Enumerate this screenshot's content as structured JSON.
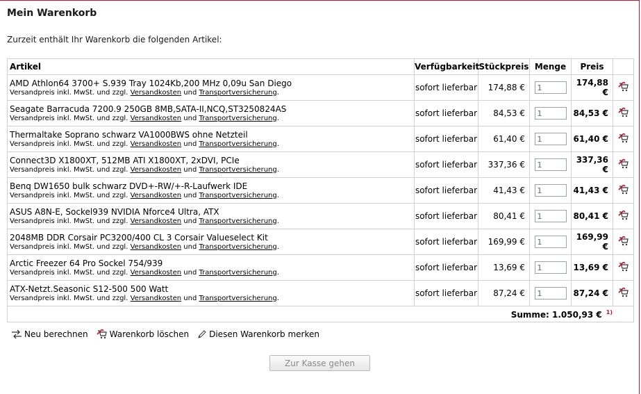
{
  "page": {
    "title": "Mein Warenkorb",
    "intro": "Zurzeit enthält Ihr Warenkorb die folgenden Artikel:"
  },
  "table": {
    "headers": {
      "article": "Artikel",
      "availability": "Verfügbarkeit",
      "unit_price": "Stückpreis",
      "quantity": "Menge",
      "price": "Preis"
    },
    "note": {
      "prefix": "Versandpreis inkl. MwSt. und zzgl. ",
      "link1": "Versandkosten",
      "middle": " und ",
      "link2": "Transportversicherung",
      "suffix": "."
    },
    "items": [
      {
        "name": "AMD Athlon64 3700+ S.939 Tray 1024Kb,200 MHz 0,09u San Diego",
        "availability": "sofort lieferbar",
        "unit_price": "174,88 €",
        "qty": "1",
        "price": "174,88 €"
      },
      {
        "name": "Seagate Barracuda 7200.9 250GB 8MB,SATA-II,NCQ,ST3250824AS",
        "availability": "sofort lieferbar",
        "unit_price": "84,53 €",
        "qty": "1",
        "price": "84,53 €"
      },
      {
        "name": "Thermaltake Soprano schwarz VA1000BWS ohne Netzteil",
        "availability": "sofort lieferbar",
        "unit_price": "61,40 €",
        "qty": "1",
        "price": "61,40 €"
      },
      {
        "name": "Connect3D X1800XT, 512MB ATI X1800XT, 2xDVI, PCIe",
        "availability": "sofort lieferbar",
        "unit_price": "337,36 €",
        "qty": "1",
        "price": "337,36 €"
      },
      {
        "name": "Benq DW1650 bulk schwarz DVD+-RW/+-R-Laufwerk IDE",
        "availability": "sofort lieferbar",
        "unit_price": "41,43 €",
        "qty": "1",
        "price": "41,43 €"
      },
      {
        "name": "ASUS A8N-E, Sockel939 NVIDIA Nforce4 Ultra, ATX",
        "availability": "sofort lieferbar",
        "unit_price": "80,41 €",
        "qty": "1",
        "price": "80,41 €"
      },
      {
        "name": "2048MB DDR Corsair PC3200/400 CL 3 Corsair Valueselect Kit",
        "availability": "sofort lieferbar",
        "unit_price": "169,99 €",
        "qty": "1",
        "price": "169,99 €"
      },
      {
        "name": "Arctic Freezer 64 Pro Sockel 754/939",
        "availability": "sofort lieferbar",
        "unit_price": "13,69 €",
        "qty": "1",
        "price": "13,69 €"
      },
      {
        "name": "ATX-Netzt.Seasonic S12-500 500 Watt",
        "availability": "sofort lieferbar",
        "unit_price": "87,24 €",
        "qty": "1",
        "price": "87,24 €"
      }
    ],
    "sum_label": "Summe: 1.050,93 €",
    "sum_footnote": "1)"
  },
  "actions": {
    "recalc": "Neu berechnen",
    "clear": "Warenkorb löschen",
    "remember": "Diesen Warenkorb merken"
  },
  "checkout": {
    "label": "Zur Kasse gehen"
  },
  "icons": {
    "delete": "cart-delete-icon",
    "recalc": "recalc-icon",
    "clear": "cart-clear-icon",
    "remember": "pencil-icon"
  },
  "colors": {
    "accent": "#c8102e",
    "border": "#d0d0d0"
  }
}
